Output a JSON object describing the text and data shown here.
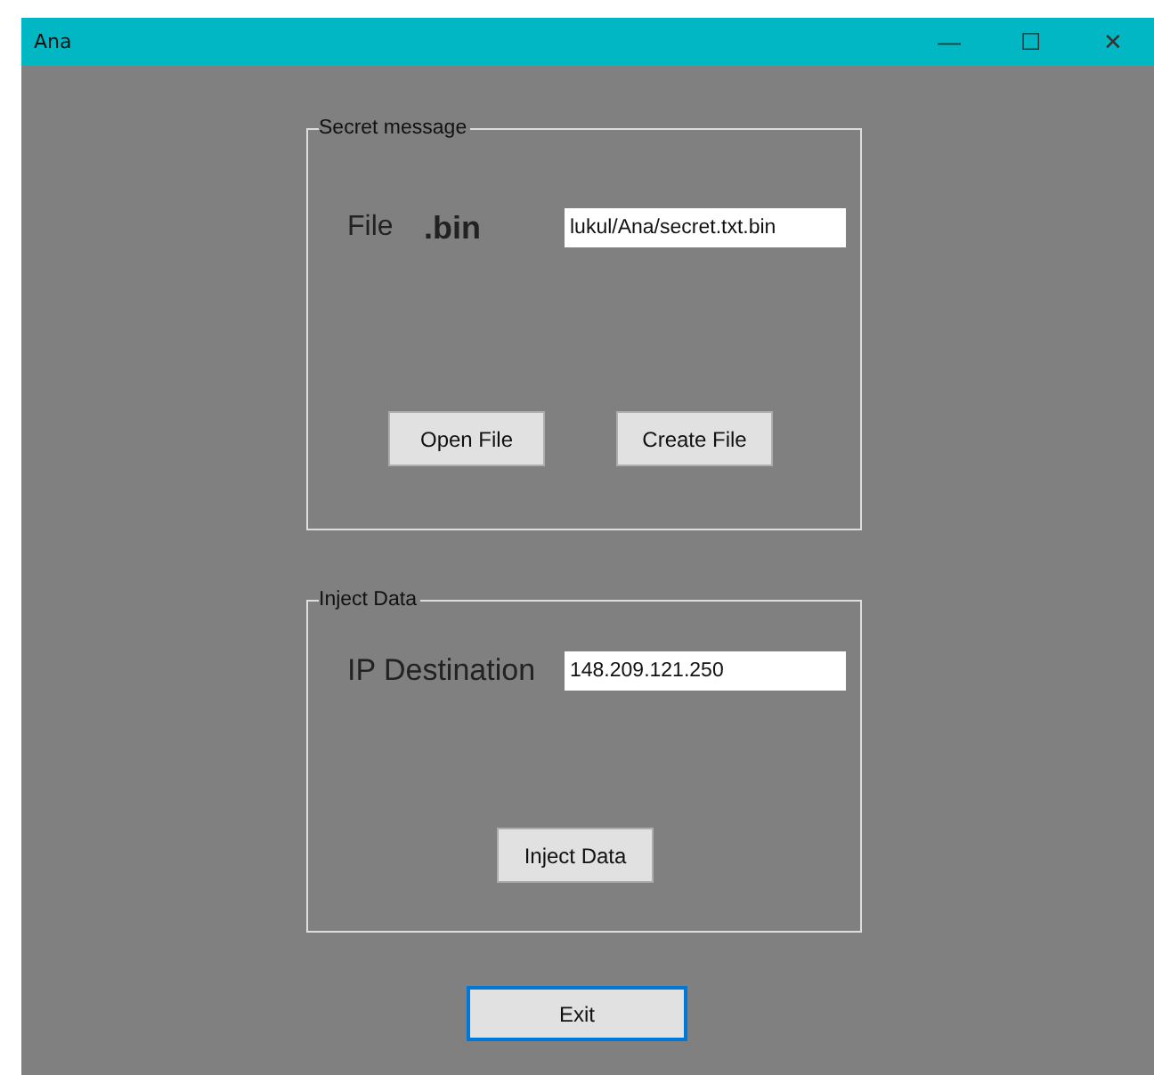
{
  "window": {
    "title": "Ana",
    "controls": [
      "—",
      "☐",
      "✕"
    ]
  },
  "secret_group": {
    "title": "Secret message",
    "file_label": "File",
    "extension": ".bin",
    "path": "lukul/Ana/secret.txt.bin",
    "buttons": [
      {
        "label": "Open File",
        "focused": false
      },
      {
        "label": "Create File",
        "focused": false
      }
    ]
  },
  "inject_group": {
    "title": "Inject Data",
    "ip_label": "IP Destination",
    "ip": "148.209.121.250",
    "button": {
      "label": "Inject Data",
      "focused": false
    }
  },
  "exit_button": {
    "label": "Exit",
    "focused": true
  }
}
